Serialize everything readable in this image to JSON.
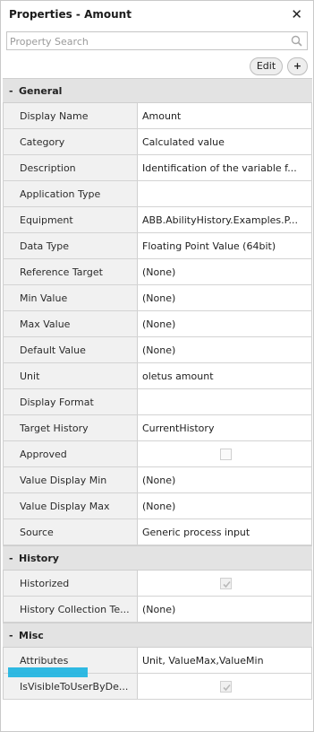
{
  "panel": {
    "title": "Properties - Amount",
    "close_glyph": "✕"
  },
  "search": {
    "placeholder": "Property Search",
    "icon": "search-icon"
  },
  "toolbar": {
    "edit_label": "Edit",
    "add_label": "+"
  },
  "sections": [
    {
      "collapse": "-",
      "label": "General",
      "rows": [
        {
          "key": "Display Name",
          "value": "Amount"
        },
        {
          "key": "Category",
          "value": "Calculated value"
        },
        {
          "key": "Description",
          "value": "Identification of the variable f..."
        },
        {
          "key": "Application Type",
          "value": ""
        },
        {
          "key": "Equipment",
          "value": "ABB.AbilityHistory.Examples.P..."
        },
        {
          "key": "Data Type",
          "value": "Floating Point Value (64bit)"
        },
        {
          "key": "Reference Target",
          "value": "(None)"
        },
        {
          "key": "Min Value",
          "value": "(None)"
        },
        {
          "key": "Max Value",
          "value": "(None)"
        },
        {
          "key": "Default Value",
          "value": "(None)"
        },
        {
          "key": "Unit",
          "value": "oletus amount"
        },
        {
          "key": "Display Format",
          "value": ""
        },
        {
          "key": "Target History",
          "value": "CurrentHistory"
        },
        {
          "key": "Approved",
          "value": "",
          "checkbox": true,
          "checked": false
        },
        {
          "key": "Value Display Min",
          "value": "(None)"
        },
        {
          "key": "Value Display Max",
          "value": "(None)"
        },
        {
          "key": "Source",
          "value": "Generic process input"
        }
      ]
    },
    {
      "collapse": "-",
      "label": "History",
      "rows": [
        {
          "key": "Historized",
          "value": "",
          "checkbox": true,
          "checked": true
        },
        {
          "key": "History Collection Te...",
          "value": "(None)"
        }
      ]
    },
    {
      "collapse": "-",
      "label": "Misc",
      "rows": [
        {
          "key": "Attributes",
          "value": "Unit, ValueMax,ValueMin"
        },
        {
          "key": "IsVisibleToUserByDe...",
          "value": "",
          "checkbox": true,
          "checked": true
        }
      ]
    }
  ],
  "colors": {
    "section_bg": "#e3e3e3",
    "key_bg": "#f1f1f1",
    "highlight": "#1ab2e0"
  }
}
